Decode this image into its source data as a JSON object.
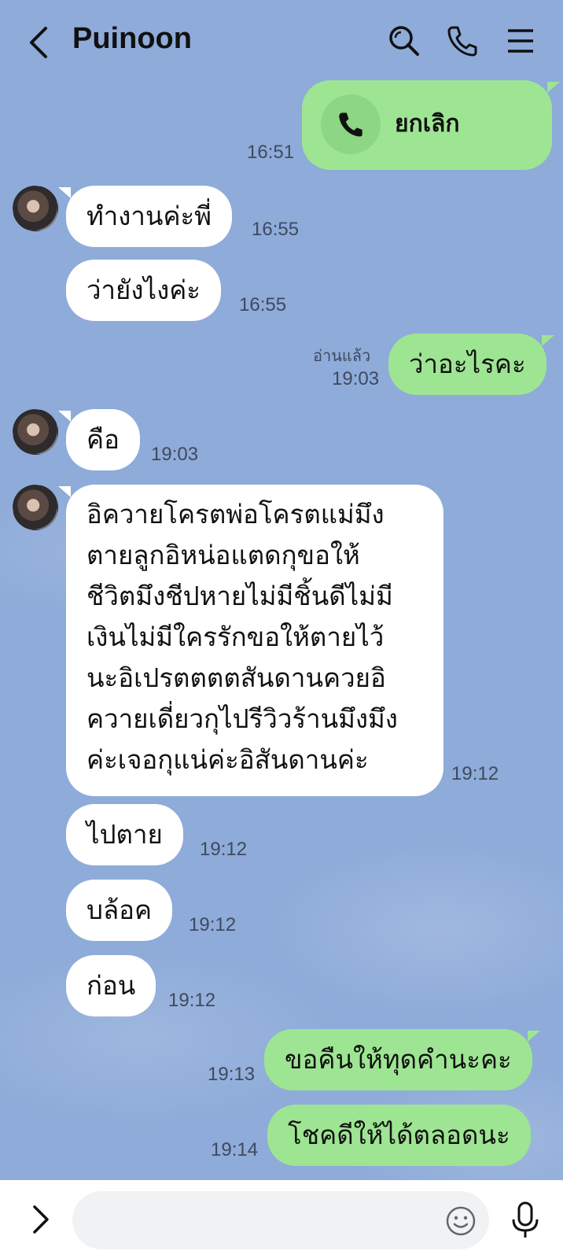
{
  "header": {
    "title": "Puinoon"
  },
  "call": {
    "label": "ยกเลิก",
    "time": "16:51"
  },
  "messages": [
    {
      "text": "ทำงานค่ะพี่",
      "time": "16:55"
    },
    {
      "text": "ว่ายังไงค่ะ",
      "time": "16:55"
    },
    {
      "text": "ว่าอะไรคะ",
      "time": "19:03",
      "read": "อ่านแล้ว"
    },
    {
      "text": "คือ",
      "time": "19:03"
    },
    {
      "lines": [
        "อิควายโครตพ่อโครตแม่มึง",
        "ตายลูกอิหน่อแตดกุขอให้",
        "ชีวิตมึงชีปหายไม่มีชิ้นดีไม่มี",
        "เงินไม่มีใครรักขอให้ตายไว้",
        "นะอิเปรตตตตสันดานควยอิ",
        "ควายเดี่ยวกุไปรีวิวร้านมึงมึง",
        "ค่ะเจอกุแน่ค่ะอิสันดานค่ะ"
      ],
      "time": "19:12"
    },
    {
      "text": "ไปตาย",
      "time": "19:12"
    },
    {
      "text": "บล้อค",
      "time": "19:12"
    },
    {
      "text": "ก่อน",
      "time": "19:12"
    },
    {
      "text": "ขอคืนให้ทุดคำนะคะ",
      "time": "19:13"
    },
    {
      "text": "โชคดีให้ได้ตลอดนะ",
      "time": "19:14"
    }
  ],
  "input": {
    "placeholder": ""
  },
  "icons": [
    "back-icon",
    "search-icon",
    "phone-icon",
    "menu-icon",
    "expand-icon",
    "emoji-icon",
    "mic-icon",
    "call-icon",
    "avatar"
  ],
  "colors": {
    "background": "#8eabd9",
    "outgoing_bubble": "#9ee593",
    "incoming_bubble": "#ffffff"
  }
}
